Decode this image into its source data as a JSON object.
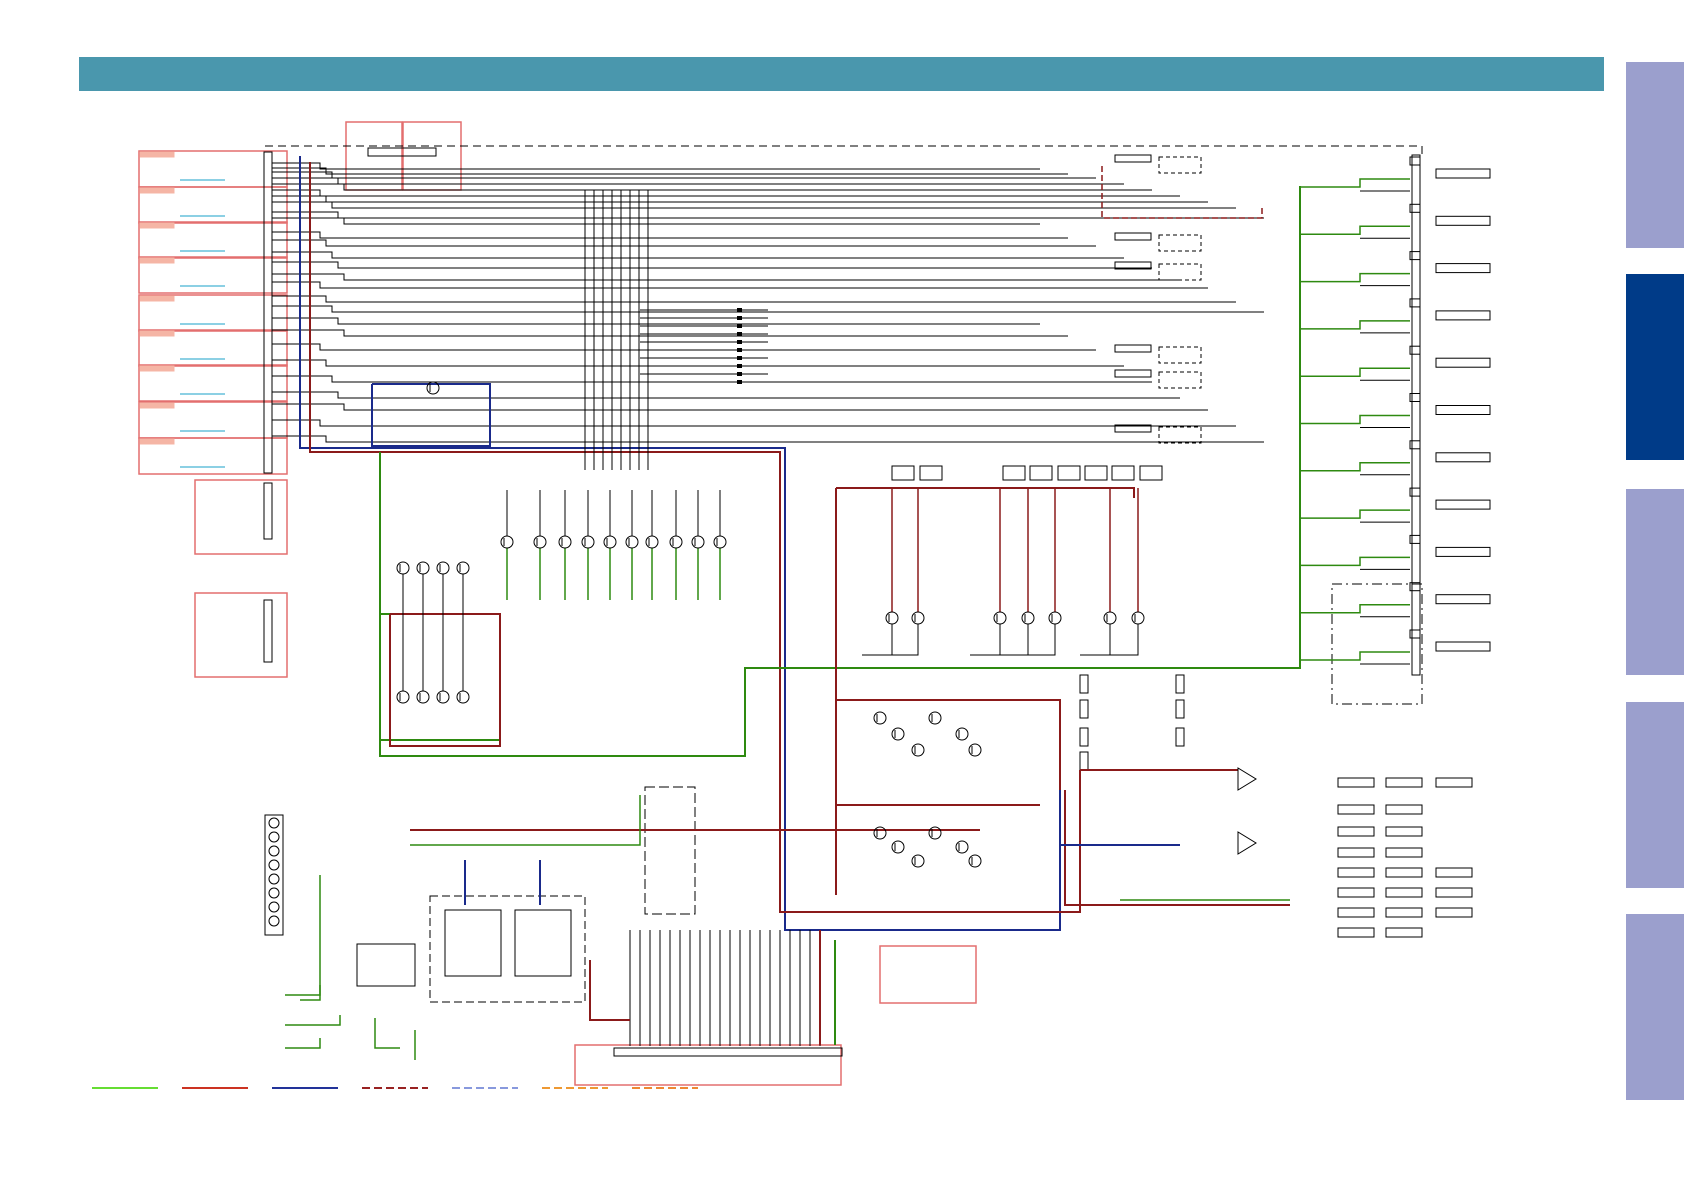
{
  "header": {
    "color": "#4a97ad"
  },
  "side_tabs": [
    {
      "id": "tab-1",
      "active": false,
      "color": "#9b9fcd"
    },
    {
      "id": "tab-2",
      "active": true,
      "color": "#003b88"
    },
    {
      "id": "tab-3",
      "active": false,
      "color": "#9b9fcd"
    },
    {
      "id": "tab-4",
      "active": false,
      "color": "#9b9fcd"
    },
    {
      "id": "tab-5",
      "active": false,
      "color": "#9b9fcd"
    }
  ],
  "diagram": {
    "wire_colors": {
      "signal": "#000000",
      "ground": "#2e8a10",
      "power_positive": "#8b1a1a",
      "power_negative": "#1a2a8b",
      "link": "#1aa0c8",
      "block": "#e36f6f"
    }
  },
  "legend": [
    {
      "style": "solid",
      "color": "#66dd33"
    },
    {
      "style": "solid",
      "color": "#cc3322"
    },
    {
      "style": "solid",
      "color": "#223399"
    },
    {
      "style": "dashed",
      "color": "#992222"
    },
    {
      "style": "dashed",
      "color": "#8899dd"
    },
    {
      "style": "dashed",
      "color": "#ee9933"
    },
    {
      "style": "dashed",
      "color": "#ee8833"
    }
  ]
}
